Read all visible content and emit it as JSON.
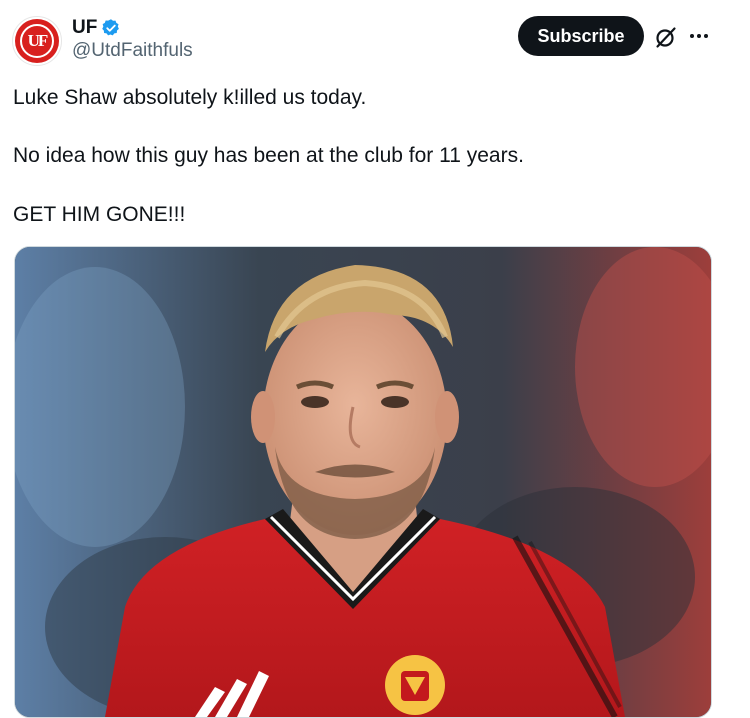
{
  "post": {
    "author": {
      "display_name": "UF",
      "handle": "@UtdFaithfuls",
      "avatar_text": "UF",
      "verified": true
    },
    "subscribe_label": "Subscribe",
    "text_lines": [
      "Luke Shaw absolutely k!illed us today.",
      "No idea how this guy has been at the club for 11 years.",
      "GET HIM GONE!!!"
    ],
    "media": {
      "icon": "photo-of-footballer",
      "description_colors": {
        "shirt": "#c3191d",
        "background": "#3a4654"
      }
    }
  },
  "colors": {
    "accent": "#1d9bf0",
    "brand_red": "#d8201e",
    "text": "#0f1419",
    "muted": "#536471"
  }
}
